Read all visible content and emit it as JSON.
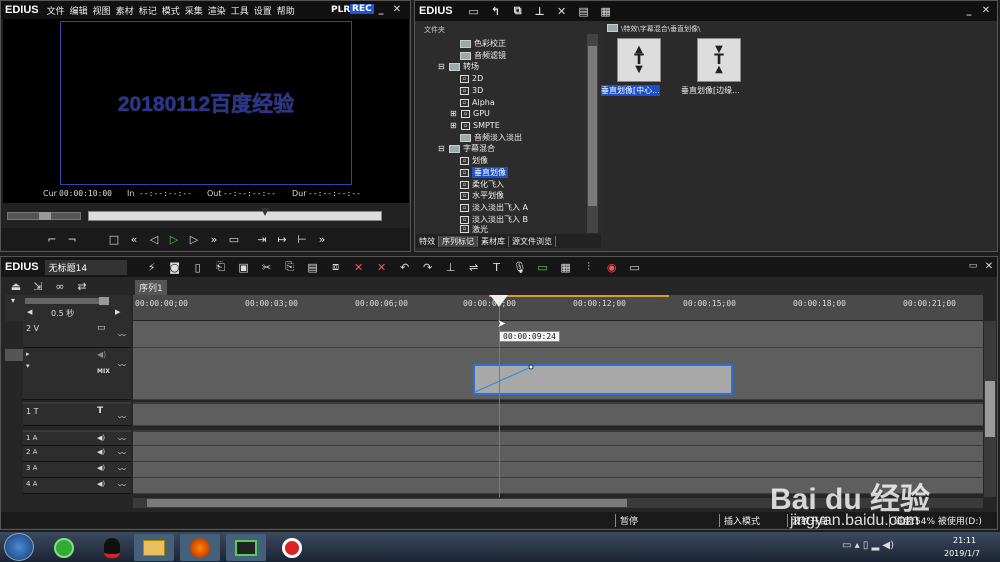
{
  "player": {
    "app_name": "EDIUS",
    "menu": [
      "文件",
      "编辑",
      "视图",
      "素材",
      "标记",
      "模式",
      "采集",
      "渲染",
      "工具",
      "设置",
      "帮助"
    ],
    "plr": "PLR",
    "rec": "REC",
    "preview_text": "20180112百度经验",
    "cur_label": "Cur",
    "cur_value": "00:00:10:00",
    "in_label": "In",
    "in_value": "--:--:--:--",
    "out_label": "Out",
    "out_value": "--:--:--:--",
    "dur_label": "Dur",
    "dur_value": "--:--:--:--"
  },
  "effects": {
    "app_name": "EDIUS",
    "folder_header": "文件夹",
    "breadcrumb": "\\特效\\字幕混合\\垂直划像\\",
    "tree": [
      "色彩校正",
      "音频滤镜",
      "转场",
      "2D",
      "3D",
      "Alpha",
      "GPU",
      "SMPTE",
      "音频淡入淡出",
      "字幕混合",
      "划像",
      "垂直划像",
      "柔化飞入",
      "水平划像",
      "淡入淡出飞入 A",
      "淡入淡出飞入 B",
      "激光"
    ],
    "items": [
      {
        "label": "垂直划像[中心..."
      },
      {
        "label": "垂直划像[边缘..."
      }
    ],
    "tabs": [
      "特效",
      "序列标记",
      "素材库",
      "源文件浏览"
    ]
  },
  "timeline": {
    "app_name": "EDIUS",
    "project_name": "无标题14",
    "sequence_tab": "序列1",
    "zoom": "0.5 秒",
    "ruler": [
      "00:00:00;00",
      "00:00:03;00",
      "00:00:06;00",
      "00:00:09;00",
      "00:00:12;00",
      "00:00:15;00",
      "00:00:18;00",
      "00:00:21;00"
    ],
    "tooltip": "00:00:09:24",
    "tracks": {
      "v2": "2 V",
      "mix": "MIX",
      "t1": "1 T",
      "a1": "1 A",
      "a2": "2 A",
      "a3": "3 A",
      "a4": "4 A"
    }
  },
  "status": {
    "pause": "暂停",
    "insert_mode": "插入模式",
    "ripple": "波纹开启",
    "disk": "磁盘:54% 被使用(D:)"
  },
  "taskbar": {
    "time": "21:11",
    "date": "2019/1/7"
  },
  "watermark": {
    "text": "Bai du 经验",
    "url": "jingyan.baidu.com"
  },
  "colors": {
    "rec": "#2255cc",
    "preview_border": "#3344aa",
    "preview_text": "#2a3590",
    "selection": "#1b50c8",
    "clip": "#a8a8a8",
    "playhead": "#2a9aa0"
  }
}
